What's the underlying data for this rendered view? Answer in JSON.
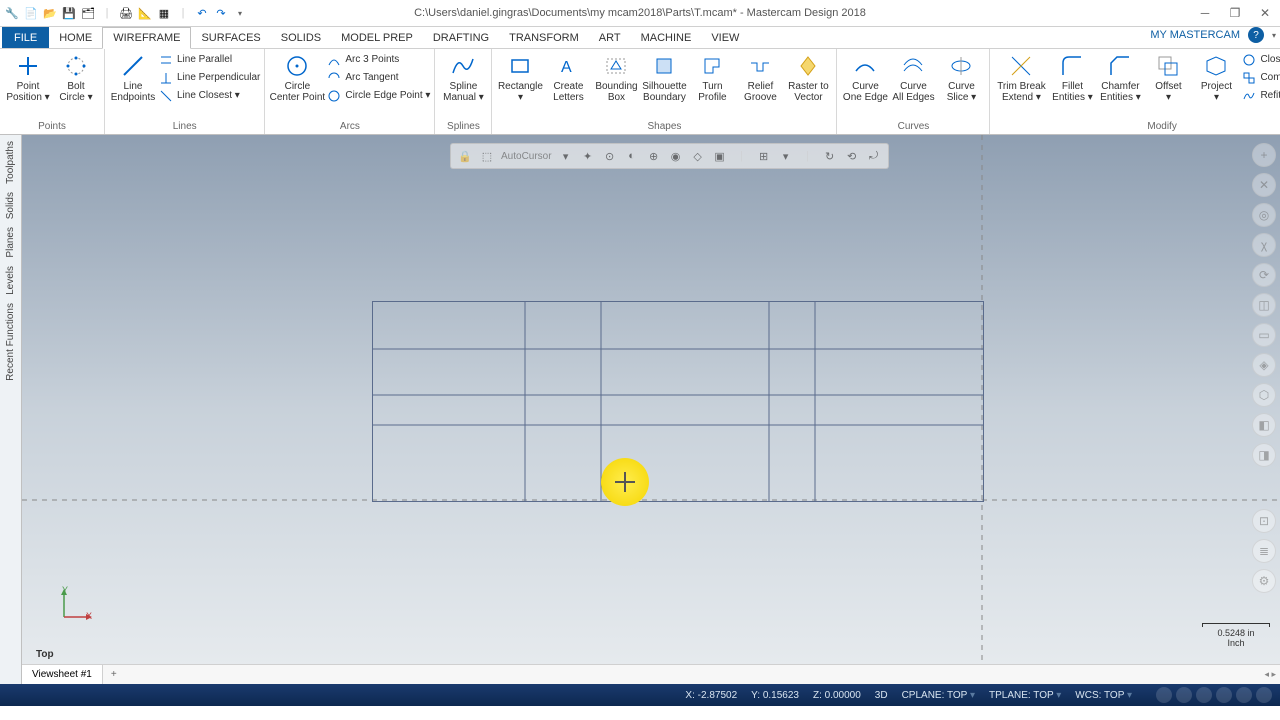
{
  "title": "C:\\Users\\daniel.gingras\\Documents\\my mcam2018\\Parts\\T.mcam* - Mastercam Design 2018",
  "qat_icons": [
    "new",
    "open",
    "save",
    "save-all",
    "|",
    "print",
    "dim",
    "layers",
    "|",
    "undo",
    "redo",
    "config"
  ],
  "menu": {
    "file": "FILE",
    "tabs": [
      "HOME",
      "WIREFRAME",
      "SURFACES",
      "SOLIDS",
      "MODEL PREP",
      "DRAFTING",
      "TRANSFORM",
      "ART",
      "MACHINE",
      "VIEW"
    ],
    "active": "WIREFRAME",
    "right": "MY MASTERCAM"
  },
  "ribbon": {
    "points": {
      "label": "Points",
      "point": "Point\nPosition ▾",
      "bolt": "Bolt\nCircle ▾"
    },
    "lines": {
      "label": "Lines",
      "line": "Line\nEndpoints",
      "items": [
        "Line Parallel",
        "Line Perpendicular",
        "Line Closest ▾"
      ]
    },
    "arcs": {
      "label": "Arcs",
      "circle": "Circle\nCenter Point",
      "items": [
        "Arc 3 Points",
        "Arc Tangent",
        "Circle Edge Point ▾"
      ]
    },
    "splines": {
      "label": "Splines",
      "spline": "Spline\nManual ▾"
    },
    "shapes": {
      "label": "Shapes",
      "btns": [
        "Rectangle\n▾",
        "Create\nLetters",
        "Bounding\nBox",
        "Silhouette\nBoundary",
        "Turn\nProfile",
        "Relief\nGroove",
        "Raster to\nVector"
      ]
    },
    "curves": {
      "label": "Curves",
      "btns": [
        "Curve\nOne Edge",
        "Curve\nAll Edges",
        "Curve\nSlice ▾"
      ]
    },
    "modify": {
      "label": "Modify",
      "btns": [
        "Trim Break\nExtend ▾",
        "Fillet\nEntities ▾",
        "Chamfer\nEntities ▾",
        "Offset\n▾",
        "Project\n▾"
      ],
      "items": [
        "Close Arc ▾",
        "Combine Views",
        "Refit Spline ▾"
      ]
    }
  },
  "side_tabs": [
    "Toolpaths",
    "Solids",
    "Planes",
    "Levels",
    "Recent Functions"
  ],
  "autocursor": "AutoCursor",
  "view_label": "Top",
  "viewsheet": "Viewsheet #1",
  "scale": {
    "value": "0.5248 in",
    "unit": "Inch"
  },
  "status": {
    "x": "X:    -2.87502",
    "y": "Y:     0.15623",
    "z": "Z:   0.00000",
    "mode": "3D",
    "cplane": "CPLANE: TOP",
    "tplane": "TPLANE: TOP",
    "wcs": "WCS: TOP"
  }
}
